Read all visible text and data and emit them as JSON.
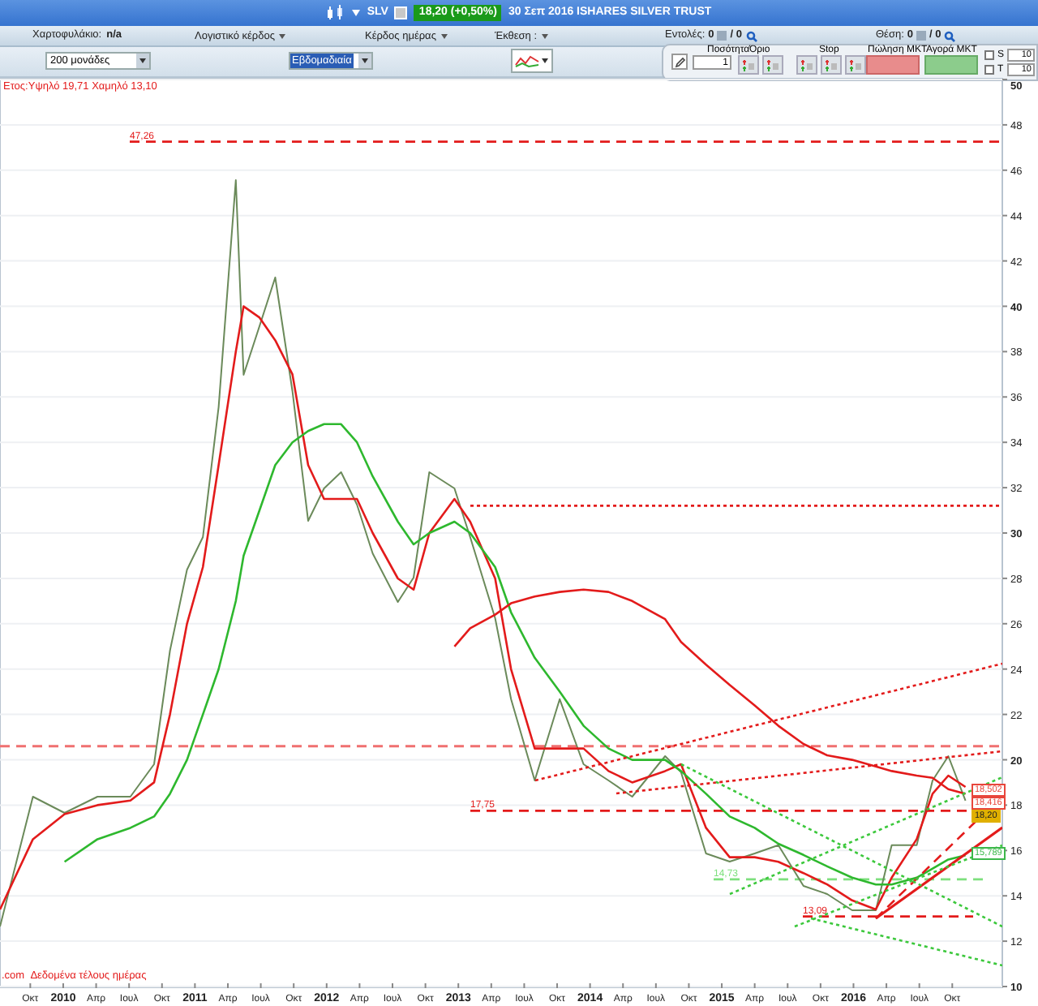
{
  "title_bar": {
    "symbol": "SLV",
    "price_change": "18,20 (+0,50%)",
    "description": "30 Σεπ 2016 ISHARES SILVER TRUST"
  },
  "info_bar": {
    "portfolio_label": "Χαρτοφυλάκιο:",
    "portfolio_value": "n/a",
    "menus": [
      "Λογιστικό κέρδος",
      "Κέρδος ημέρας",
      "Έκθεση :"
    ],
    "orders_label": "Εντολές:",
    "orders_count": "0",
    "orders_total": "/ 0",
    "position_label": "Θέση:",
    "position_count": "0",
    "position_total": "/ 0"
  },
  "toolbar": {
    "units_select": "200 μονάδες",
    "period_select": "Εβδομαδιαία",
    "quantity_label": "Ποσότητα",
    "quantity": "1",
    "limit_label": "Όριο",
    "stop_label": "Stop",
    "sell_label": "Πώληση MKT",
    "buy_label": "Αγορά MKT",
    "options": [
      {
        "label": "S",
        "checked": false,
        "value": "10"
      },
      {
        "label": "T",
        "checked": false,
        "value": "10"
      }
    ]
  },
  "chart": {
    "range_note": "Ετος:Υψηλό 19,71 Χαμηλό 13,10",
    "source_note": ".com  Δεδομένα τέλους ημέρας",
    "price_tags": [
      {
        "text": "18,502",
        "color": "#e8463c"
      },
      {
        "text": "18,416",
        "color": "#e8463c"
      },
      {
        "text": "18,20",
        "color": "#e0b000"
      },
      {
        "text": "15,789",
        "color": "#3cb84a"
      }
    ],
    "chart_data": {
      "type": "line",
      "grid": true,
      "xlim": [
        2009.52,
        2017.13
      ],
      "ylim": [
        10,
        50
      ],
      "x": [
        2009.52,
        2009.77,
        2010.01,
        2010.26,
        2010.51,
        2010.69,
        2010.81,
        2010.94,
        2011.06,
        2011.18,
        2011.31,
        2011.37,
        2011.49,
        2011.61,
        2011.74,
        2011.86,
        2011.98,
        2012.11,
        2012.23,
        2012.35,
        2012.54,
        2012.66,
        2012.78,
        2012.97,
        2013.09,
        2013.28,
        2013.4,
        2013.58,
        2013.77,
        2013.95,
        2014.14,
        2014.32,
        2014.57,
        2014.69,
        2014.88,
        2015.06,
        2015.25,
        2015.43,
        2015.62,
        2015.8,
        2015.99,
        2016.17,
        2016.29,
        2016.48,
        2016.6,
        2016.72,
        2016.85
      ],
      "series": [
        {
          "color": "#6b8a5a",
          "values": [
            12.65,
            18.37,
            17.66,
            18.37,
            18.37,
            19.8,
            24.81,
            28.38,
            29.82,
            35.55,
            45.56,
            36.98,
            39.12,
            41.27,
            36.26,
            30.54,
            31.97,
            32.68,
            31.25,
            29.1,
            26.96,
            28.03,
            32.68,
            31.97,
            29.82,
            26.24,
            22.67,
            19.09,
            22.67,
            19.8,
            19.09,
            18.37,
            20.16,
            19.45,
            15.87,
            15.51,
            15.87,
            16.23,
            14.44,
            14.08,
            13.36,
            13.36,
            16.23,
            16.23,
            19.09,
            20.16,
            18.2
          ]
        },
        {
          "color": "#e31b1b",
          "values": [
            13.4,
            16.5,
            17.6,
            18,
            18.2,
            19,
            22,
            26,
            28.5,
            33,
            38,
            40,
            39.5,
            38.5,
            37,
            33,
            31.5,
            31.5,
            31.5,
            30,
            28,
            27.5,
            30,
            31.5,
            30.5,
            28,
            24,
            20.5,
            20.5,
            20.5,
            19.5,
            19,
            19.5,
            19.8,
            17,
            15.7,
            15.7,
            15.5,
            15,
            14.5,
            13.8,
            13.4,
            14.8,
            16.5,
            18.5,
            19.3,
            18.8
          ]
        },
        {
          "color": "#2eb82e",
          "values": [
            null,
            null,
            15.5,
            16.5,
            17,
            17.5,
            18.5,
            20,
            22,
            24,
            27,
            29,
            31,
            33,
            34,
            34.5,
            34.8,
            34.8,
            34,
            32.5,
            30.5,
            29.5,
            30,
            30.5,
            30,
            28.5,
            26.5,
            24.5,
            23,
            21.5,
            20.5,
            20,
            20,
            19.5,
            18.5,
            17.5,
            17,
            16.3,
            15.8,
            15.3,
            14.8,
            14.5,
            14.5,
            14.8,
            15.2,
            15.6,
            15.79
          ]
        },
        {
          "color": "#e31b1b",
          "values": [
            null,
            null,
            null,
            null,
            null,
            null,
            null,
            null,
            null,
            null,
            null,
            null,
            null,
            null,
            null,
            null,
            null,
            null,
            null,
            null,
            null,
            null,
            null,
            25,
            25.8,
            26.4,
            26.9,
            27.2,
            27.4,
            27.5,
            27.4,
            27,
            26.2,
            25.2,
            24.2,
            23.3,
            22.4,
            21.5,
            20.7,
            20.2,
            20,
            19.7,
            19.5,
            19.3,
            19.2,
            18.7,
            18.5
          ]
        }
      ],
      "xticks": [
        {
          "value": 2009.75,
          "label": "Οκτ"
        },
        {
          "value": 2010,
          "label": "2010"
        },
        {
          "value": 2010.25,
          "label": "Απρ"
        },
        {
          "value": 2010.5,
          "label": "Ιουλ"
        },
        {
          "value": 2010.75,
          "label": "Οκτ"
        },
        {
          "value": 2011,
          "label": "2011"
        },
        {
          "value": 2011.25,
          "label": "Απρ"
        },
        {
          "value": 2011.5,
          "label": "Ιουλ"
        },
        {
          "value": 2011.75,
          "label": "Οκτ"
        },
        {
          "value": 2012,
          "label": "2012"
        },
        {
          "value": 2012.25,
          "label": "Απρ"
        },
        {
          "value": 2012.5,
          "label": "Ιουλ"
        },
        {
          "value": 2012.75,
          "label": "Οκτ"
        },
        {
          "value": 2013,
          "label": "2013"
        },
        {
          "value": 2013.25,
          "label": "Απρ"
        },
        {
          "value": 2013.5,
          "label": "Ιουλ"
        },
        {
          "value": 2013.75,
          "label": "Οκτ"
        },
        {
          "value": 2014,
          "label": "2014"
        },
        {
          "value": 2014.25,
          "label": "Απρ"
        },
        {
          "value": 2014.5,
          "label": "Ιουλ"
        },
        {
          "value": 2014.75,
          "label": "Οκτ"
        },
        {
          "value": 2015,
          "label": "2015"
        },
        {
          "value": 2015.25,
          "label": "Απρ"
        },
        {
          "value": 2015.5,
          "label": "Ιουλ"
        },
        {
          "value": 2015.75,
          "label": "Οκτ"
        },
        {
          "value": 2016,
          "label": "2016"
        },
        {
          "value": 2016.25,
          "label": "Απρ"
        },
        {
          "value": 2016.5,
          "label": "Ιουλ"
        },
        {
          "value": 2016.75,
          "label": "Οκτ"
        }
      ],
      "yticks": [
        10,
        12,
        14,
        16,
        18,
        20,
        22,
        24,
        26,
        28,
        30,
        32,
        34,
        36,
        38,
        40,
        42,
        44,
        46,
        48,
        50
      ],
      "ref_lines": [
        {
          "axis": "y",
          "value": 47.26,
          "label": "47,26"
        },
        {
          "axis": "y",
          "value": 31.2
        },
        {
          "axis": "y",
          "value": 20.6
        },
        {
          "axis": "y",
          "value": 17.75,
          "label": "17,75"
        },
        {
          "axis": "y",
          "value": 14.73,
          "label": "14,73"
        },
        {
          "axis": "y",
          "value": 13.09,
          "label": "13,09"
        }
      ]
    }
  }
}
